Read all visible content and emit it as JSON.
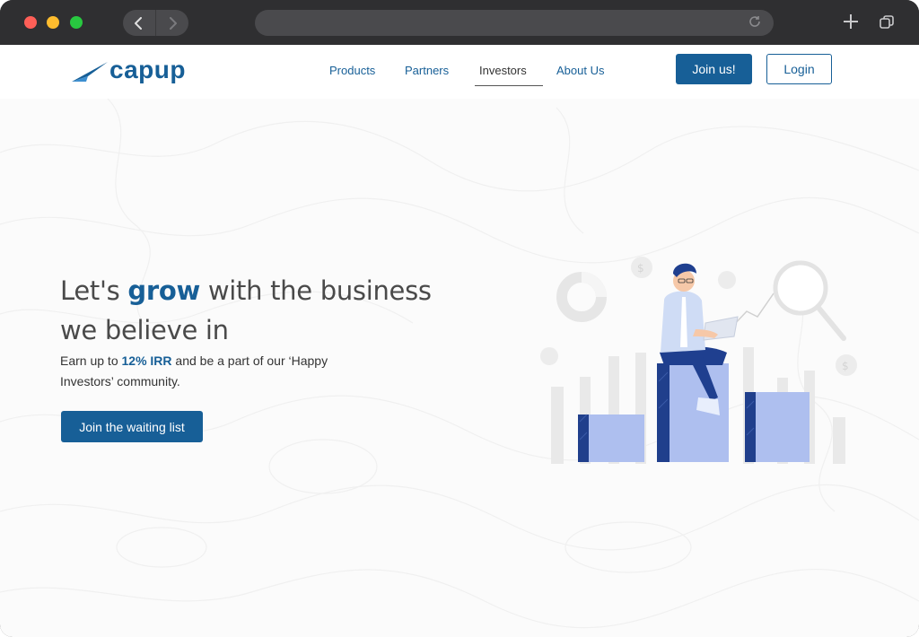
{
  "browser": {
    "back_icon": "chevron-left-icon",
    "forward_icon": "chevron-right-icon",
    "reload_icon": "reload-icon",
    "new_tab_icon": "plus-icon",
    "tabs_icon": "tabs-overview-icon"
  },
  "brand": {
    "logo_text": "capup",
    "primary_color": "#175f97"
  },
  "nav": {
    "items": [
      {
        "label": "Products"
      },
      {
        "label": "Partners"
      },
      {
        "label": "Investors",
        "active": true
      },
      {
        "label": "About Us"
      }
    ],
    "join_label": "Join us!",
    "login_label": "Login"
  },
  "hero": {
    "title_part1": "Let's ",
    "title_accent": "grow",
    "title_part2": " with the business we believe in",
    "sub_part1": "Earn up to ",
    "sub_accent": "12% IRR",
    "sub_part2": " and be a part of our ‘Happy Investors’ community.",
    "cta_label": "Join the waiting list"
  }
}
